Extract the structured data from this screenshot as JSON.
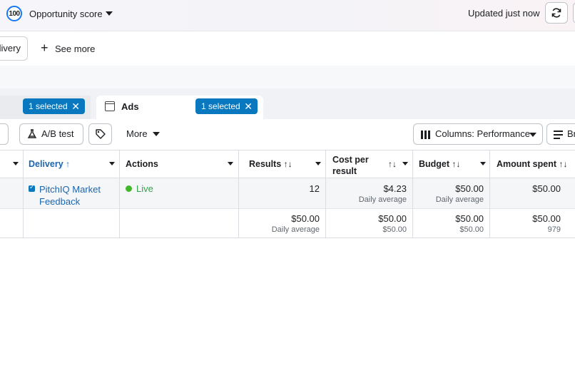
{
  "topbar": {
    "score_badge": "100",
    "score_label": "Opportunity score",
    "updated_text": "Updated just now",
    "refresh_icon": "refresh-icon"
  },
  "filters": {
    "delivery_chip": "livery",
    "see_more": "See more"
  },
  "tabs": {
    "left_selected": "1 selected",
    "ads_label": "Ads",
    "ads_selected": "1 selected"
  },
  "toolbar": {
    "ab_test": "A/B test",
    "more": "More",
    "columns": "Columns: Performance",
    "breakdown_partial": "Br"
  },
  "table": {
    "headers": {
      "delivery": "Delivery",
      "actions": "Actions",
      "results": "Results",
      "cost_per_result_1": "Cost per",
      "cost_per_result_2": "result",
      "budget": "Budget",
      "amount_spent": "Amount spent"
    },
    "row": {
      "name_1": "PitchIQ Market",
      "name_2": "Feedback",
      "status": "Live",
      "results": "12",
      "cost": "$4.23",
      "cost_sub": "Daily average",
      "budget": "$50.00",
      "budget_sub": "Daily average",
      "spent": "$50.00"
    },
    "totals": {
      "results": "$50.00",
      "results_sub": "Daily average",
      "cost": "$50.00",
      "cost_sub": "$50.00",
      "budget": "$50.00",
      "budget_sub": "$50.00",
      "spent": "$50.00",
      "spent_sub": "979"
    }
  },
  "colors": {
    "accent": "#0a78be",
    "live": "#42b72a",
    "link": "#1a66b0"
  }
}
